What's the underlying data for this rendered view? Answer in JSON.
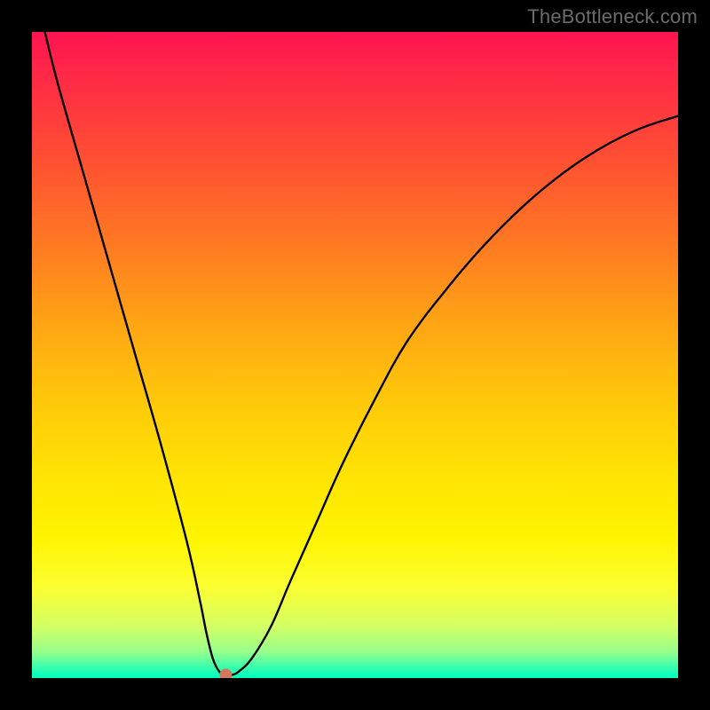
{
  "watermark": "TheBottleneck.com",
  "chart_data": {
    "type": "line",
    "title": "",
    "xlabel": "",
    "ylabel": "",
    "xlim": [
      0,
      100
    ],
    "ylim": [
      0,
      100
    ],
    "grid": false,
    "series": [
      {
        "name": "curve",
        "x": [
          2,
          4,
          8,
          12,
          16,
          20,
          24,
          26,
          27,
          28,
          29,
          30,
          31,
          32,
          34,
          37,
          40,
          44,
          48,
          53,
          58,
          64,
          70,
          76,
          82,
          88,
          94,
          100
        ],
        "y": [
          100,
          92,
          78,
          64,
          50,
          36,
          21,
          12,
          7,
          3,
          1,
          0.5,
          0.5,
          1,
          3,
          8,
          15,
          24,
          33,
          43,
          52,
          60,
          67,
          73,
          78,
          82,
          85,
          87
        ]
      }
    ],
    "marker": {
      "x": 30,
      "y": 0.5,
      "color": "#d4785d",
      "radius": 7
    },
    "background_gradient": {
      "direction": "vertical",
      "stops": [
        {
          "pos": 0.0,
          "color": "#ff1450"
        },
        {
          "pos": 0.5,
          "color": "#ffc80a"
        },
        {
          "pos": 0.85,
          "color": "#fbff32"
        },
        {
          "pos": 1.0,
          "color": "#00ffbe"
        }
      ]
    }
  }
}
